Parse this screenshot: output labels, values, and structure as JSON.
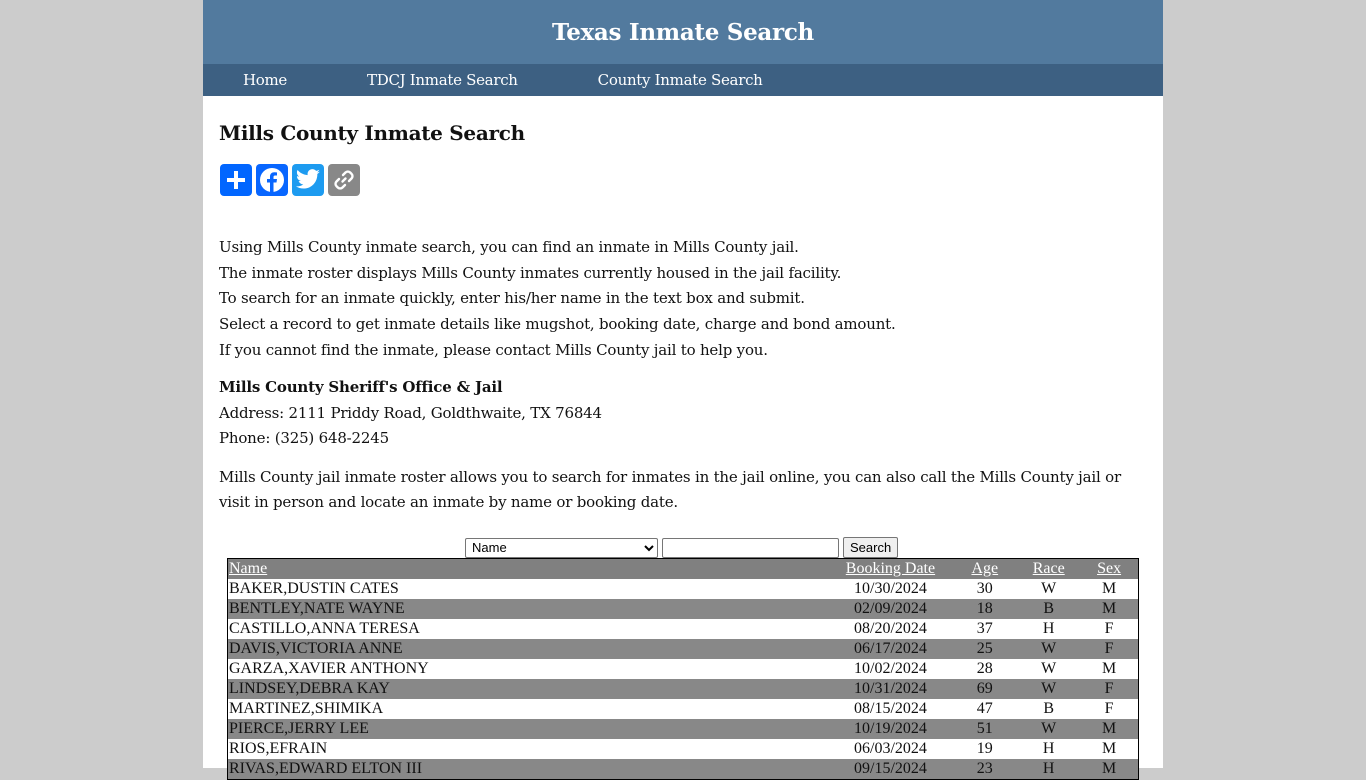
{
  "site": {
    "title": "Texas Inmate Search",
    "nav": [
      {
        "label": "Home"
      },
      {
        "label": "TDCJ Inmate Search"
      },
      {
        "label": "County Inmate Search"
      }
    ]
  },
  "page": {
    "heading": "Mills County Inmate Search",
    "share": [
      {
        "name": "add-share",
        "icon": "plus-icon",
        "color": "#0166ff"
      },
      {
        "name": "facebook-share",
        "icon": "facebook-icon",
        "color": "#0866ff"
      },
      {
        "name": "twitter-share",
        "icon": "twitter-icon",
        "color": "#1d9bf0"
      },
      {
        "name": "copy-link",
        "icon": "link-icon",
        "color": "#888888"
      }
    ],
    "intro": [
      "Using Mills County inmate search, you can find an inmate in Mills County jail.",
      "The inmate roster displays Mills County inmates currently housed in the jail facility.",
      "To search for an inmate quickly, enter his/her name in the text box and submit.",
      "Select a record to get inmate details like mugshot, booking date, charge and bond amount.",
      "If you cannot find the inmate, please contact Mills County jail to help you."
    ],
    "office": {
      "title": "Mills County Sheriff's Office & Jail",
      "address": "Address: 2111 Priddy Road, Goldthwaite, TX 76844",
      "phone": "Phone: (325) 648-2245"
    },
    "roster_text": "Mills County jail inmate roster allows you to search for inmates in the jail online, you can also call the Mills County jail or visit in person and locate an inmate by name or booking date."
  },
  "search": {
    "field_selected": "Name",
    "query_value": "",
    "button_label": "Search"
  },
  "table": {
    "headers": {
      "name": "Name",
      "booking_date": "Booking Date",
      "age": "Age",
      "race": "Race",
      "sex": "Sex"
    },
    "rows": [
      {
        "name": "BAKER,DUSTIN CATES",
        "booking_date": "10/30/2024",
        "age": "30",
        "race": "W",
        "sex": "M"
      },
      {
        "name": "BENTLEY,NATE WAYNE",
        "booking_date": "02/09/2024",
        "age": "18",
        "race": "B",
        "sex": "M"
      },
      {
        "name": "CASTILLO,ANNA TERESA",
        "booking_date": "08/20/2024",
        "age": "37",
        "race": "H",
        "sex": "F"
      },
      {
        "name": "DAVIS,VICTORIA ANNE",
        "booking_date": "06/17/2024",
        "age": "25",
        "race": "W",
        "sex": "F"
      },
      {
        "name": "GARZA,XAVIER ANTHONY",
        "booking_date": "10/02/2024",
        "age": "28",
        "race": "W",
        "sex": "M"
      },
      {
        "name": "LINDSEY,DEBRA KAY",
        "booking_date": "10/31/2024",
        "age": "69",
        "race": "W",
        "sex": "F"
      },
      {
        "name": "MARTINEZ,SHIMIKA",
        "booking_date": "08/15/2024",
        "age": "47",
        "race": "B",
        "sex": "F"
      },
      {
        "name": "PIERCE,JERRY LEE",
        "booking_date": "10/19/2024",
        "age": "51",
        "race": "W",
        "sex": "M"
      },
      {
        "name": "RIOS,EFRAIN",
        "booking_date": "06/03/2024",
        "age": "19",
        "race": "H",
        "sex": "M"
      },
      {
        "name": "RIVAS,EDWARD ELTON III",
        "booking_date": "09/15/2024",
        "age": "23",
        "race": "H",
        "sex": "M"
      }
    ]
  }
}
